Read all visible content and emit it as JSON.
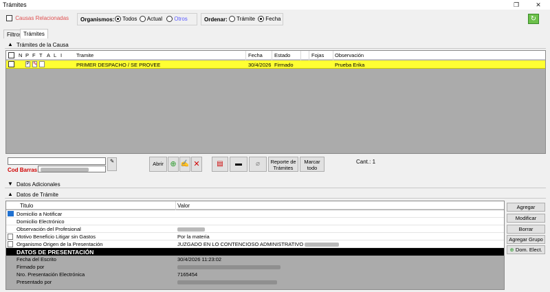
{
  "window": {
    "title": "Trámites"
  },
  "filters": {
    "causas_relacionadas": "Causas Relacionadas",
    "organismos_label": "Organismos:",
    "organismos_options": [
      "Todos",
      "Actual",
      "Otros"
    ],
    "ordenar_label": "Ordenar:",
    "ordenar_options": [
      "Trámite",
      "Fecha"
    ]
  },
  "tabs": [
    "Filtros",
    "Trámites"
  ],
  "sections": {
    "tramites_causa": "Trámites de la Causa",
    "datos_adicionales": "Datos Adicionales",
    "datos_tramite": "Datos de Trámite"
  },
  "grid": {
    "columns": [
      "N",
      "P",
      "F",
      "T",
      "A",
      "L",
      "I",
      "Tramite",
      "Fecha",
      "Estado",
      "Fojas",
      "Observación"
    ],
    "rows": [
      {
        "tramite": "PRIMER DESPACHO / SE PROVEE",
        "fecha": "30/4/2026",
        "estado": "Firmado",
        "fojas": "",
        "observacion": "Prueba Erika"
      }
    ]
  },
  "toolbar": {
    "cod_barras_label": "Cod Barras:",
    "abrir": "Abrir",
    "reporte": "Reporte de Trámites",
    "marcar": "Marcar todo",
    "cant": "Cant.: 1"
  },
  "details": {
    "col_titulo": "Titulo",
    "col_valor": "Valor",
    "rows": [
      {
        "k": "Domicilio a Notificar",
        "v": ""
      },
      {
        "k": "Domicilio Electrónico",
        "v": ""
      },
      {
        "k": "Observación del Profesional",
        "v": ""
      },
      {
        "k": "Motivo Beneficio Litigar sin Gastos",
        "v": "Por la materia"
      },
      {
        "k": "Organismo Origen de la Presentación",
        "v": "JUZGADO EN LO CONTENCIOSO ADMINISTRATIVO"
      },
      {
        "k": "DATOS DE PRESENTACIÓN",
        "v": ""
      },
      {
        "k": "Fecha del Escrito",
        "v": "30/4/2026 11:23:02"
      },
      {
        "k": "Firmado por",
        "v": ""
      },
      {
        "k": "Nro. Presentación Electrónica",
        "v": "7165454"
      },
      {
        "k": "Presentado por",
        "v": ""
      }
    ]
  },
  "side_buttons": [
    "Agregar",
    "Modificar",
    "Borrar",
    "Agregar Grupo",
    "Dom. Elect."
  ],
  "colors": {
    "highlight_row": "#ffff33",
    "causas_text": "#e05050",
    "otros_text": "#5a5aff",
    "cod_barras_text": "#d00000"
  }
}
